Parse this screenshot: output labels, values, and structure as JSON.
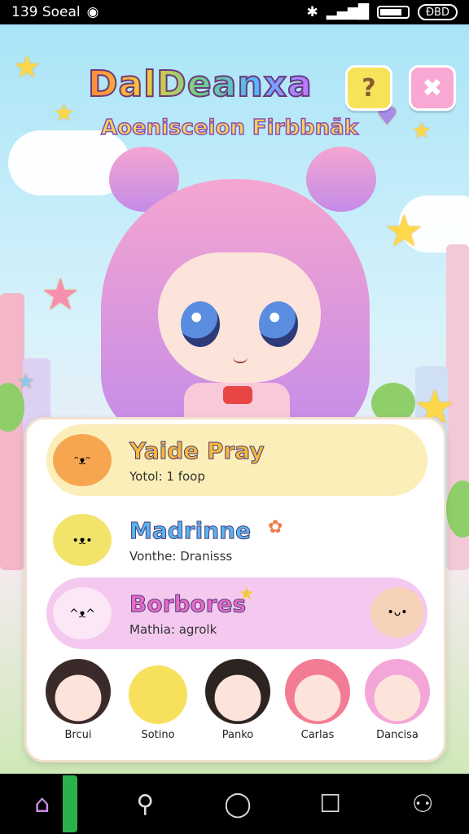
{
  "status_bar": {
    "time": "139 Soeal",
    "battery_label": "ĐBD"
  },
  "header": {
    "title": "DalDeanxa",
    "subtitle": "Aoenisceion Firbbnäk",
    "help_label": "?",
    "close_label": "✖"
  },
  "list": {
    "items": [
      {
        "name": "Yaide Pray",
        "detail": "Yotol: 1 foop",
        "color": "#fbeeb8"
      },
      {
        "name": "Madrinne",
        "detail": "Vonthe: Dranisss",
        "color": "#ffffff"
      },
      {
        "name": "Borbores",
        "detail": "Mathia: agrolk",
        "color": "#f5c8ef"
      }
    ]
  },
  "roster": {
    "items": [
      {
        "label": "Brcui",
        "icon": "girl-avatar-icon"
      },
      {
        "label": "Sotino",
        "icon": "cat-avatar-icon"
      },
      {
        "label": "Panko",
        "icon": "girl-avatar-icon"
      },
      {
        "label": "Carlas",
        "icon": "girl-avatar-icon"
      },
      {
        "label": "Dancisa",
        "icon": "girl-avatar-icon"
      }
    ]
  },
  "nav": {
    "home_icon": "home-icon",
    "search_icon": "search-icon",
    "chat_icon": "chat-icon",
    "square_icon": "recent-apps-icon",
    "profile_icon": "profile-icon"
  }
}
